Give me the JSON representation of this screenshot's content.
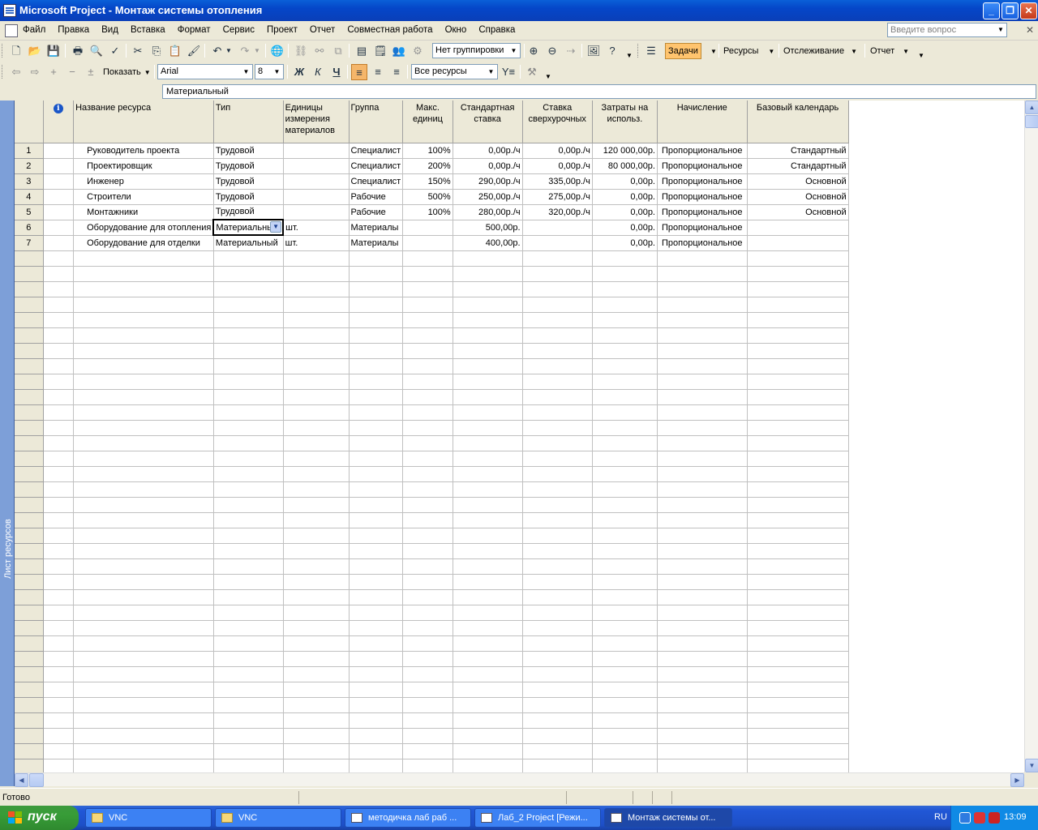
{
  "window": {
    "title": "Microsoft Project - Монтаж системы отопления"
  },
  "menu": [
    "Файл",
    "Правка",
    "Вид",
    "Вставка",
    "Формат",
    "Сервис",
    "Проект",
    "Отчет",
    "Совместная работа",
    "Окно",
    "Справка"
  ],
  "help_box": {
    "placeholder": "Введите вопрос"
  },
  "toolbar1": {
    "grouping": "Нет группировки",
    "guide": {
      "tasks": "Задачи",
      "resources": "Ресурсы",
      "tracking": "Отслеживание",
      "report": "Отчет"
    }
  },
  "toolbar2": {
    "show_label": "Показать",
    "font": "Arial",
    "size": "8",
    "bold": "Ж",
    "italic": "К",
    "underline": "Ч",
    "filter": "Все ресурсы"
  },
  "entry_bar": {
    "value": "Материальный"
  },
  "view_bar": {
    "label": "Лист ресурсов"
  },
  "sheet": {
    "columns": {
      "info": "i",
      "name": "Название ресурса",
      "type": "Тип",
      "units": "Единицы измерения материалов",
      "group": "Группа",
      "max": "Макс. единиц",
      "std_rate": "Стандартная ставка",
      "ovt_rate": "Ставка сверхурочных",
      "cost_use": "Затраты на использ.",
      "accrue": "Начисление",
      "calendar": "Базовый календарь"
    },
    "rows": [
      {
        "id": "1",
        "name": "Руководитель проекта",
        "type": "Трудовой",
        "units": "",
        "group": "Специалист",
        "max": "100%",
        "std_rate": "0,00р./ч",
        "ovt_rate": "0,00р./ч",
        "cost_use": "120 000,00р.",
        "accrue": "Пропорциональное",
        "calendar": "Стандартный"
      },
      {
        "id": "2",
        "name": "Проектировщик",
        "type": "Трудовой",
        "units": "",
        "group": "Специалист",
        "max": "200%",
        "std_rate": "0,00р./ч",
        "ovt_rate": "0,00р./ч",
        "cost_use": "80 000,00р.",
        "accrue": "Пропорциональное",
        "calendar": "Стандартный"
      },
      {
        "id": "3",
        "name": "Инженер",
        "type": "Трудовой",
        "units": "",
        "group": "Специалист",
        "max": "150%",
        "std_rate": "290,00р./ч",
        "ovt_rate": "335,00р./ч",
        "cost_use": "0,00р.",
        "accrue": "Пропорциональное",
        "calendar": "Основной"
      },
      {
        "id": "4",
        "name": "Строители",
        "type": "Трудовой",
        "units": "",
        "group": "Рабочие",
        "max": "500%",
        "std_rate": "250,00р./ч",
        "ovt_rate": "275,00р./ч",
        "cost_use": "0,00р.",
        "accrue": "Пропорциональное",
        "calendar": "Основной"
      },
      {
        "id": "5",
        "name": "Монтажники",
        "type": "Трудовой",
        "units": "",
        "group": "Рабочие",
        "max": "100%",
        "std_rate": "280,00р./ч",
        "ovt_rate": "320,00р./ч",
        "cost_use": "0,00р.",
        "accrue": "Пропорциональное",
        "calendar": "Основной"
      },
      {
        "id": "6",
        "name": "Оборудование для отопления",
        "type": "Материальный",
        "units": "шт.",
        "group": "Материалы",
        "max": "",
        "std_rate": "500,00р.",
        "ovt_rate": "",
        "cost_use": "0,00р.",
        "accrue": "Пропорциональное",
        "calendar": ""
      },
      {
        "id": "7",
        "name": "Оборудование для отделки",
        "type": "Материальный",
        "units": "шт.",
        "group": "Материалы",
        "max": "",
        "std_rate": "400,00р.",
        "ovt_rate": "",
        "cost_use": "0,00р.",
        "accrue": "Пропорциональное",
        "calendar": ""
      }
    ]
  },
  "status": {
    "text": "Готово"
  },
  "taskbar": {
    "start": "пуск",
    "tasks": [
      "VNC",
      "VNC",
      "методичка лаб раб ...",
      "Лаб_2 Project [Режи...",
      "Монтаж системы от..."
    ],
    "lang": "RU",
    "clock": "13:09"
  }
}
